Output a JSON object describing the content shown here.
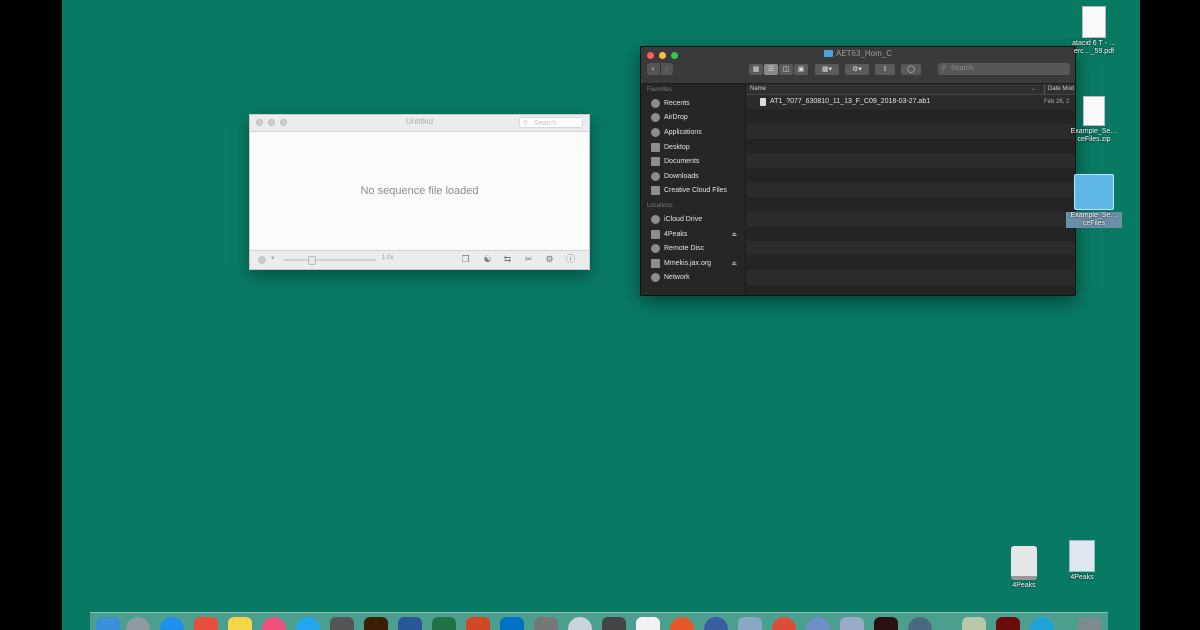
{
  "sequence_window": {
    "title": "Untitled",
    "search_placeholder": "Search",
    "empty_message": "No sequence file loaded",
    "speed_label": "1.0x"
  },
  "finder": {
    "title": "AET63_Hom_C",
    "search_placeholder": "Search",
    "sidebar": {
      "favorites_heading": "Favorites",
      "locations_heading": "Locations",
      "favorites": [
        "Recents",
        "AirDrop",
        "Applications",
        "Desktop",
        "Documents",
        "Downloads",
        "Creative Cloud Files"
      ],
      "locations": [
        "iCloud Drive",
        "4Peaks",
        "Remote Disc",
        "Mmekis.jax.org",
        "Network"
      ]
    },
    "columns": {
      "name": "Name",
      "date": "Date Mod"
    },
    "files": [
      {
        "name": "AT1_?077_630810_11_13_F_C09_2018-03-27.ab1",
        "date": "Feb 26, 2"
      }
    ]
  },
  "desktop_icons": {
    "pdf_label": "atacid 6 T - …erc…_59.pdf",
    "zip_label": "Example_Se…ceFiles.zip",
    "folder_label": "Example_Se…ceFiles",
    "disk_label": "4Peaks",
    "app_label": "4Peaks"
  },
  "colors": {
    "desktop": "#087a64",
    "finder_bg": "#2b2b2b",
    "traffic_red": "#fc605c",
    "traffic_yellow": "#fdbc40",
    "traffic_green": "#34c84a"
  }
}
